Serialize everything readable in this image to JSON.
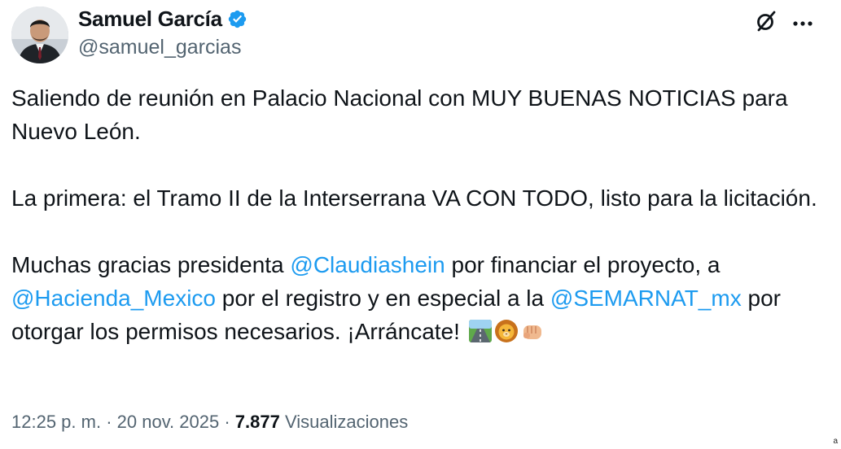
{
  "author": {
    "name": "Samuel García",
    "handle": "@samuel_garcias",
    "verified": true,
    "verified_color": "#1d9bf0",
    "avatar_icon": "profile-photo"
  },
  "actions": {
    "grok_icon": "grok-icon",
    "more_icon": "more-icon"
  },
  "tweet": {
    "p1": "Saliendo de reunión en Palacio Nacional con MUY BUENAS NOTICIAS para Nuevo León.",
    "p2": "La primera: el Tramo II de la Interserrana VA CON TODO, listo para la licitación.",
    "p3_a": "Muchas gracias presidenta ",
    "p3_mention1": "@Claudiashein",
    "p3_b": " por financiar el proyecto, a ",
    "p3_mention2": "@Hacienda_Mexico",
    "p3_c": " por el registro y en especial a la ",
    "p3_mention3": "@SEMARNAT_mx",
    "p3_d": " por otorgar los permisos necesarios. ¡Arráncate! ",
    "emojis": [
      "motorway-emoji",
      "lion-emoji",
      "fist-emoji"
    ],
    "mention_color": "#1d9bf0"
  },
  "meta": {
    "time": "12:25 p. m.",
    "sep1": " · ",
    "date": "20 nov. 2025",
    "sep2": " · ",
    "views_count": "7.877",
    "views_label": " Visualizaciones"
  },
  "corner_mark": "a"
}
